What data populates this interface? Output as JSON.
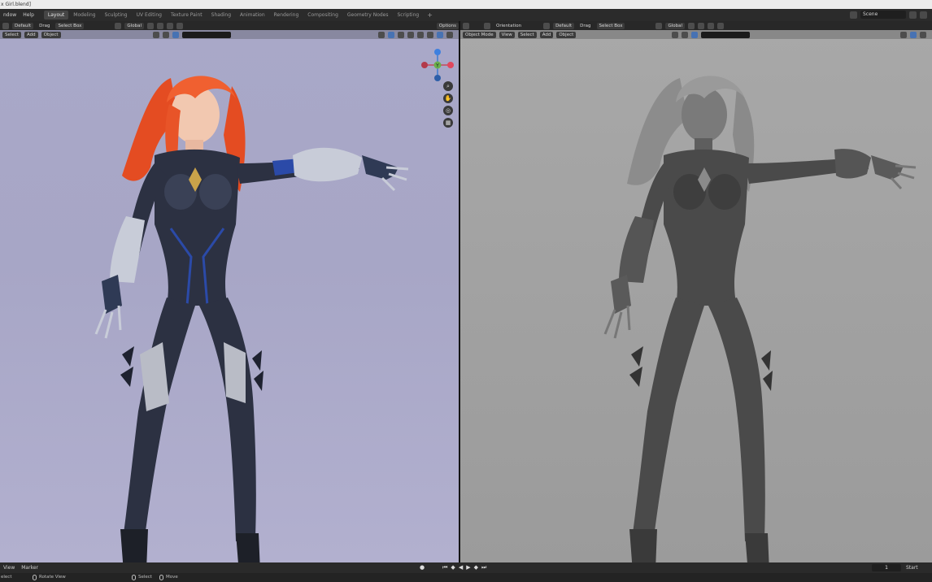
{
  "window": {
    "title": "x Girl.blend]"
  },
  "topmenu": {
    "menus": [
      "ndow",
      "Help"
    ],
    "workspaces": [
      "Layout",
      "Modeling",
      "Sculpting",
      "UV Editing",
      "Texture Paint",
      "Shading",
      "Animation",
      "Rendering",
      "Compositing",
      "Geometry Nodes",
      "Scripting"
    ],
    "active_workspace": "Layout",
    "add_tab": "+",
    "scene_label": "Scene"
  },
  "left_viewport": {
    "header": {
      "orientation_value": "Default",
      "drag_label": "Drag",
      "select_mode": "Select Box",
      "transform_orientation": "Global",
      "options_label": "Options"
    },
    "menu": [
      "Select",
      "Add",
      "Object"
    ],
    "shading": "material-preview",
    "gizmo_axes": [
      "X",
      "Y",
      "Z"
    ],
    "nav_icons": [
      "zoom-icon",
      "hand-pan-icon",
      "camera-icon",
      "grid-icon"
    ]
  },
  "right_viewport": {
    "header": {
      "orientation_label": "Orientation",
      "orientation_value": "Default",
      "drag_label": "Drag",
      "select_mode": "Select Box",
      "transform_orientation": "Global"
    },
    "mode": "Object Mode",
    "menu": [
      "View",
      "Select",
      "Add",
      "Object"
    ],
    "shading": "solid"
  },
  "timeline": {
    "menus": [
      "View",
      "Marker"
    ],
    "current_frame": "1",
    "start_label": "Start"
  },
  "statusbar": {
    "items": [
      "elect",
      "Rotate View",
      "Select",
      "Move"
    ]
  },
  "colors": {
    "hair": "#e8542a",
    "suit": "#2a3040",
    "accent_blue": "#2b4aa8",
    "armor": "#c8ccd8",
    "clay": "#5a5a5a"
  }
}
